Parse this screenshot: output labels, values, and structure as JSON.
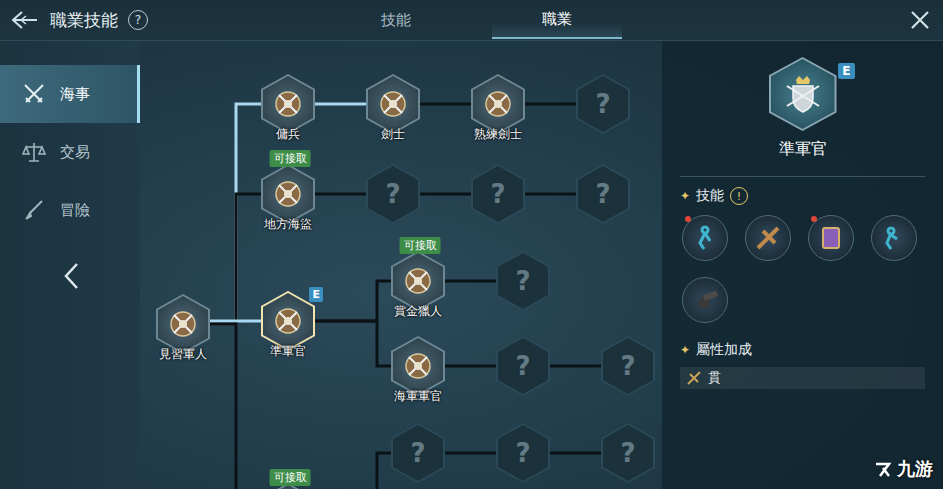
{
  "window": {
    "title": "職業技能",
    "help": "?"
  },
  "tabs": [
    {
      "label": "技能",
      "selected": false
    },
    {
      "label": "職業",
      "selected": true
    }
  ],
  "sidebar": {
    "items": [
      {
        "label": "海事",
        "selected": true
      },
      {
        "label": "交易",
        "selected": false
      },
      {
        "label": "冒險",
        "selected": false
      }
    ]
  },
  "tree": {
    "nodes": [
      {
        "label": "見習軍人",
        "known": true,
        "badge": "",
        "equipped": "",
        "selected": false,
        "path_active": true
      },
      {
        "label": "傭兵",
        "known": true,
        "badge": "",
        "equipped": "",
        "selected": false,
        "path_active": true
      },
      {
        "label": "劍士",
        "known": true,
        "badge": "",
        "equipped": "",
        "selected": false,
        "path_active": true
      },
      {
        "label": "熟練劍士",
        "known": true,
        "badge": "",
        "equipped": "",
        "selected": false,
        "path_active": false
      },
      {
        "label": "?",
        "known": false,
        "badge": "",
        "equipped": "",
        "selected": false,
        "path_active": false
      },
      {
        "label": "地方海盜",
        "known": true,
        "badge": "可接取",
        "equipped": "",
        "selected": false,
        "path_active": false
      },
      {
        "label": "?",
        "known": false,
        "badge": "",
        "equipped": "",
        "selected": false,
        "path_active": false
      },
      {
        "label": "?",
        "known": false,
        "badge": "",
        "equipped": "",
        "selected": false,
        "path_active": false
      },
      {
        "label": "?",
        "known": false,
        "badge": "",
        "equipped": "",
        "selected": false,
        "path_active": false
      },
      {
        "label": "準軍官",
        "known": true,
        "badge": "",
        "equipped": "E",
        "selected": true,
        "path_active": true
      },
      {
        "label": "賞金獵人",
        "known": true,
        "badge": "可接取",
        "equipped": "",
        "selected": false,
        "path_active": false
      },
      {
        "label": "?",
        "known": false,
        "badge": "",
        "equipped": "",
        "selected": false,
        "path_active": false
      },
      {
        "label": "海軍軍官",
        "known": true,
        "badge": "",
        "equipped": "",
        "selected": false,
        "path_active": false
      },
      {
        "label": "?",
        "known": false,
        "badge": "",
        "equipped": "",
        "selected": false,
        "path_active": false
      },
      {
        "label": "?",
        "known": false,
        "badge": "",
        "equipped": "",
        "selected": false,
        "path_active": false
      },
      {
        "label": "?",
        "known": false,
        "badge": "",
        "equipped": "",
        "selected": false,
        "path_active": false
      },
      {
        "label": "?",
        "known": false,
        "badge": "",
        "equipped": "",
        "selected": false,
        "path_active": false
      },
      {
        "label": "?",
        "known": false,
        "badge": "",
        "equipped": "",
        "selected": false,
        "path_active": false
      },
      {
        "label": "",
        "known": true,
        "badge": "可接取",
        "equipped": "",
        "selected": false,
        "path_active": false
      }
    ]
  },
  "detail": {
    "title": "準軍官",
    "equipped": "E",
    "heading_mark": "✦",
    "skills_heading": "技能",
    "skills_alert": "!",
    "skills": [
      {
        "marked": true
      },
      {
        "marked": false
      },
      {
        "marked": true
      },
      {
        "marked": false
      },
      {
        "marked": false
      }
    ],
    "attributes_heading": "屬性加成",
    "attributes": [
      "貫"
    ]
  },
  "watermark": "九游"
}
